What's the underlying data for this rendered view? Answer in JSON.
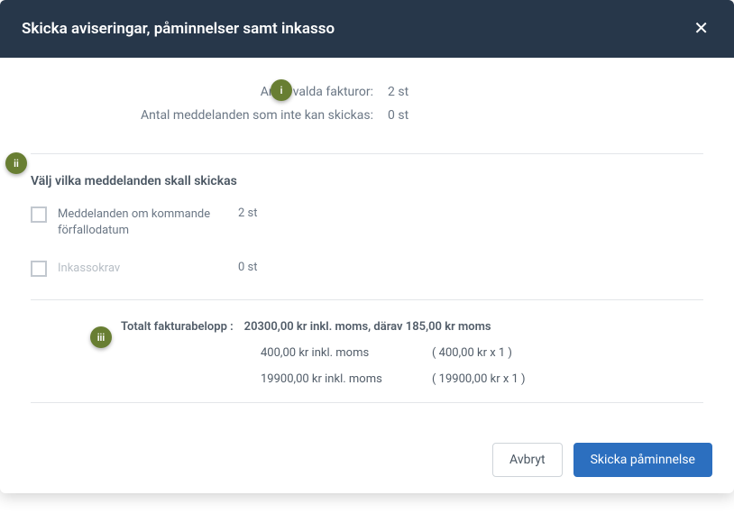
{
  "header": {
    "title": "Skicka aviseringar, påminnelser samt inkasso"
  },
  "badges": {
    "i": "i",
    "ii": "ii",
    "iii": "iii"
  },
  "info": {
    "invoices_label": "Antal valda fakturor:",
    "invoices_value": "2 st",
    "unsendable_label": "Antal meddelanden som inte kan skickas:",
    "unsendable_value": "0 st"
  },
  "section": {
    "title": "Välj vilka meddelanden skall skickas",
    "options": [
      {
        "label": "Meddelanden om kommande förfallodatum",
        "count": "2 st",
        "muted": false
      },
      {
        "label": "Inkassokrav",
        "count": "0 st",
        "muted": true
      }
    ]
  },
  "totals": {
    "label": "Totalt fakturabelopp :",
    "summary": "20300,00 kr inkl. moms, därav 185,00 kr moms",
    "lines": [
      {
        "amount": "400,00 kr inkl. moms",
        "calc": "( 400,00 kr x 1 )"
      },
      {
        "amount": "19900,00 kr inkl. moms",
        "calc": "( 19900,00 kr x 1 )"
      }
    ]
  },
  "footer": {
    "cancel": "Avbryt",
    "submit": "Skicka påminnelse"
  }
}
